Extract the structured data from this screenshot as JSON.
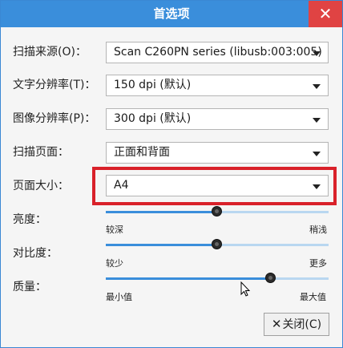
{
  "window": {
    "title": "首选项",
    "close_glyph": "✕"
  },
  "rows": {
    "source": {
      "label": "扫描来源(O)：",
      "value": "Scan C260PN series (libusb:003:005)"
    },
    "text_res": {
      "label": "文字分辨率(T)：",
      "value": "150 dpi (默认)"
    },
    "photo_res": {
      "label": "图像分辨率(P)：",
      "value": "300 dpi (默认)"
    },
    "scan_sides": {
      "label": "扫描页面：",
      "value": "正面和背面"
    },
    "page_size": {
      "label": "页面大小：",
      "value": "A4"
    }
  },
  "sliders": {
    "brightness": {
      "label": "亮度：",
      "min_label": "较深",
      "max_label": "稍浅",
      "value": 0.5
    },
    "contrast": {
      "label": "对比度：",
      "min_label": "较少",
      "max_label": "更多",
      "value": 0.5
    },
    "quality": {
      "label": "质量：",
      "min_label": "最小值",
      "max_label": "最大值",
      "value": 0.74
    }
  },
  "buttons": {
    "close_label": "关闭(C)",
    "close_icon": "✕"
  },
  "colors": {
    "titlebar": "#3a8edb",
    "close": "#e04343",
    "highlight": "#d9212a"
  }
}
